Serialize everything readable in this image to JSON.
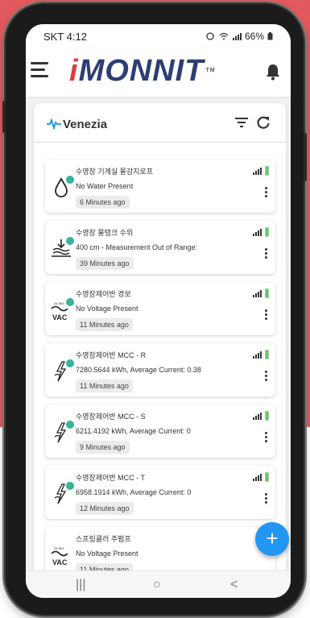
{
  "status_bar": {
    "carrier_time": "SKT 4:12",
    "battery_percent": "66%"
  },
  "app_bar": {
    "logo_text": "MONNIT",
    "logo_mark": "i",
    "logo_tm": "TM"
  },
  "network": {
    "name": "Venezia"
  },
  "sensors": [
    {
      "title": "수영장 기계실 물감지로프",
      "reading": "No Water Present",
      "time": "6 Minutes ago",
      "icon": "water-drop-icon"
    },
    {
      "title": "수영장 물탱크 수위",
      "reading": "400 cm - Measurement Out of Range:",
      "time": "39 Minutes ago",
      "icon": "water-level-icon"
    },
    {
      "title": "수영장제어반 경보",
      "reading": "No Voltage Present",
      "time": "11 Minutes ago",
      "icon": "vac-icon"
    },
    {
      "title": "수영장제어반 MCC - R",
      "reading": "7280.5644 kWh, Average Current: 0.38",
      "time": "11 Minutes ago",
      "icon": "current-meter-icon"
    },
    {
      "title": "수영장제어반 MCC - S",
      "reading": "6211.4192 kWh, Average Current: 0",
      "time": "9 Minutes ago",
      "icon": "current-meter-icon"
    },
    {
      "title": "수영장제어반 MCC - T",
      "reading": "6958.1914 kWh, Average Current: 0",
      "time": "12 Minutes ago",
      "icon": "current-meter-icon"
    },
    {
      "title": "스프링클러 주펌프",
      "reading": "No Voltage Present",
      "time": "11 Minutes ago",
      "icon": "vac-icon"
    }
  ],
  "vac_icon_label": "VAC",
  "vac_icon_sub": "24-500",
  "fab_label": "+",
  "nav": {
    "recent": "|||",
    "home": "○",
    "back": "<"
  },
  "colors": {
    "background_accent": "#e35a5e",
    "logo_blue": "#2c3e73",
    "logo_red": "#e03a3e",
    "status_dot": "#36b39a",
    "fab": "#2196f3",
    "battery": "#6cc26a"
  }
}
